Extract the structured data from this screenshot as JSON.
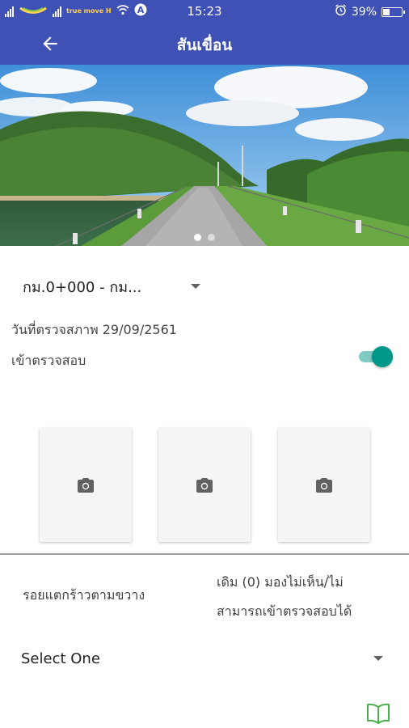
{
  "status_bar": {
    "carrier": "true move H",
    "time": "15:23",
    "battery": "39%",
    "battery_level": 0.39,
    "icons": [
      "signal-icon",
      "carrier-logo",
      "signal-icon",
      "wifi-icon",
      "notification-a-icon",
      "alarm-icon",
      "battery-icon"
    ]
  },
  "app_bar": {
    "title": "สันเขื่อน",
    "back_icon": "arrow-left-icon"
  },
  "carousel": {
    "slide_count": 2,
    "active_index": 0
  },
  "section": {
    "selected": "กม.0+000 - กม..."
  },
  "inspection": {
    "date_line": "วันที่ตรวจสภาพ 29/09/2561",
    "inspect_label": "เข้าตรวจสอบ",
    "inspect_enabled": true,
    "toggle_color": "#009688"
  },
  "photos": {
    "slots": [
      {
        "icon": "camera-icon"
      },
      {
        "icon": "camera-icon"
      },
      {
        "icon": "camera-icon"
      }
    ]
  },
  "defect": {
    "label": "รอยแตกร้าวตามขวาง",
    "status_line1": "เดิม (0) มองไม่เห็น/ไม่",
    "status_line2": "สามารถเข้าตรวจสอบได้",
    "select_value": "Select One",
    "guide_icon": "book-icon",
    "guide_icon_color": "#4caf50"
  },
  "colors": {
    "primary": "#3f51b5",
    "accent": "#009688"
  }
}
